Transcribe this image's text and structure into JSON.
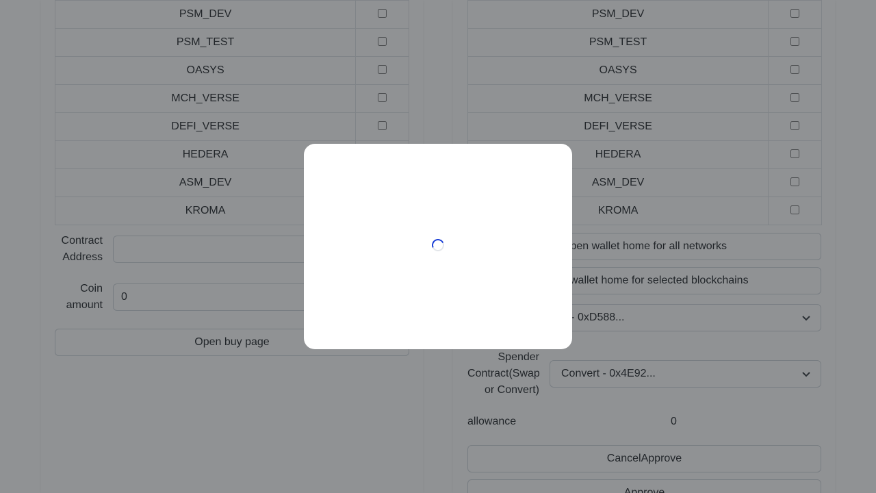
{
  "left_panel": {
    "chains": [
      "PSM_DEV",
      "PSM_TEST",
      "OASYS",
      "MCH_VERSE",
      "DEFI_VERSE",
      "HEDERA",
      "ASM_DEV",
      "KROMA"
    ],
    "contract_address": {
      "label": "Contract Address",
      "value": ""
    },
    "coin_amount": {
      "label": "Coin amount",
      "value": "0"
    },
    "open_buy_page_label": "Open buy page"
  },
  "right_panel": {
    "chains": [
      "PSM_DEV",
      "PSM_TEST",
      "OASYS",
      "MCH_VERSE",
      "DEFI_VERSE",
      "HEDERA",
      "ASM_DEV",
      "KROMA"
    ],
    "open_wallet_all_label": "Open wallet home for all networks",
    "open_wallet_selected_label": "Open wallet home for selected blockchains",
    "token_select_value": "A - 0xD588...",
    "spender": {
      "label": "Spender Contract(Swap or Convert)",
      "value": "Convert - 0x4E92..."
    },
    "allowance": {
      "label": "allowance",
      "value": "0"
    },
    "cancel_approve_label": "CancelApprove",
    "approve_label": "Approve"
  },
  "modal": {
    "state": "loading",
    "spinner_color": "#1a3fd6"
  },
  "colors": {
    "overlay": "rgba(33,37,41,0.5)",
    "border": "#ced4da"
  },
  "icons": {
    "select_arrow": "chevron-down-icon",
    "loader": "spinner-icon"
  }
}
